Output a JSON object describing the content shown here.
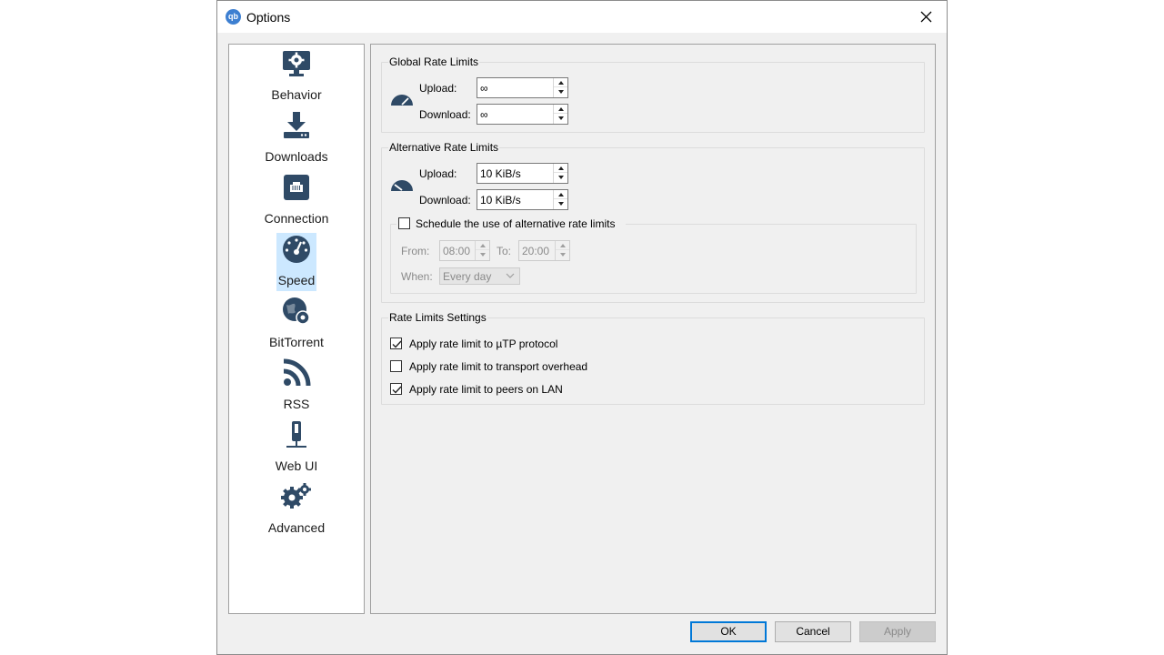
{
  "window": {
    "title": "Options",
    "app_icon": "qb"
  },
  "sidebar": {
    "items": [
      {
        "label": "Behavior",
        "icon": "monitor-gear-icon"
      },
      {
        "label": "Downloads",
        "icon": "download-tray-icon"
      },
      {
        "label": "Connection",
        "icon": "ethernet-port-icon"
      },
      {
        "label": "Speed",
        "icon": "speedometer-icon",
        "selected": true
      },
      {
        "label": "BitTorrent",
        "icon": "globe-gear-icon"
      },
      {
        "label": "RSS",
        "icon": "rss-icon"
      },
      {
        "label": "Web UI",
        "icon": "plug-icon"
      },
      {
        "label": "Advanced",
        "icon": "gears-icon"
      }
    ]
  },
  "global_limits": {
    "title": "Global Rate Limits",
    "upload_label": "Upload:",
    "upload_value": "∞",
    "download_label": "Download:",
    "download_value": "∞"
  },
  "alt_limits": {
    "title": "Alternative Rate Limits",
    "upload_label": "Upload:",
    "upload_value": "10 KiB/s",
    "download_label": "Download:",
    "download_value": "10 KiB/s",
    "schedule_label": "Schedule the use of alternative rate limits",
    "schedule_checked": false,
    "from_label": "From:",
    "from_value": "08:00",
    "to_label": "To:",
    "to_value": "20:00",
    "when_label": "When:",
    "when_value": "Every day"
  },
  "rate_settings": {
    "title": "Rate Limits Settings",
    "options": [
      {
        "label": "Apply rate limit to µTP protocol",
        "checked": true
      },
      {
        "label": "Apply rate limit to transport overhead",
        "checked": false
      },
      {
        "label": "Apply rate limit to peers on LAN",
        "checked": true
      }
    ]
  },
  "buttons": {
    "ok": "OK",
    "cancel": "Cancel",
    "apply": "Apply"
  },
  "colors": {
    "accent": "#0078d7",
    "icon": "#2f4a66",
    "selection": "#cce8ff"
  }
}
